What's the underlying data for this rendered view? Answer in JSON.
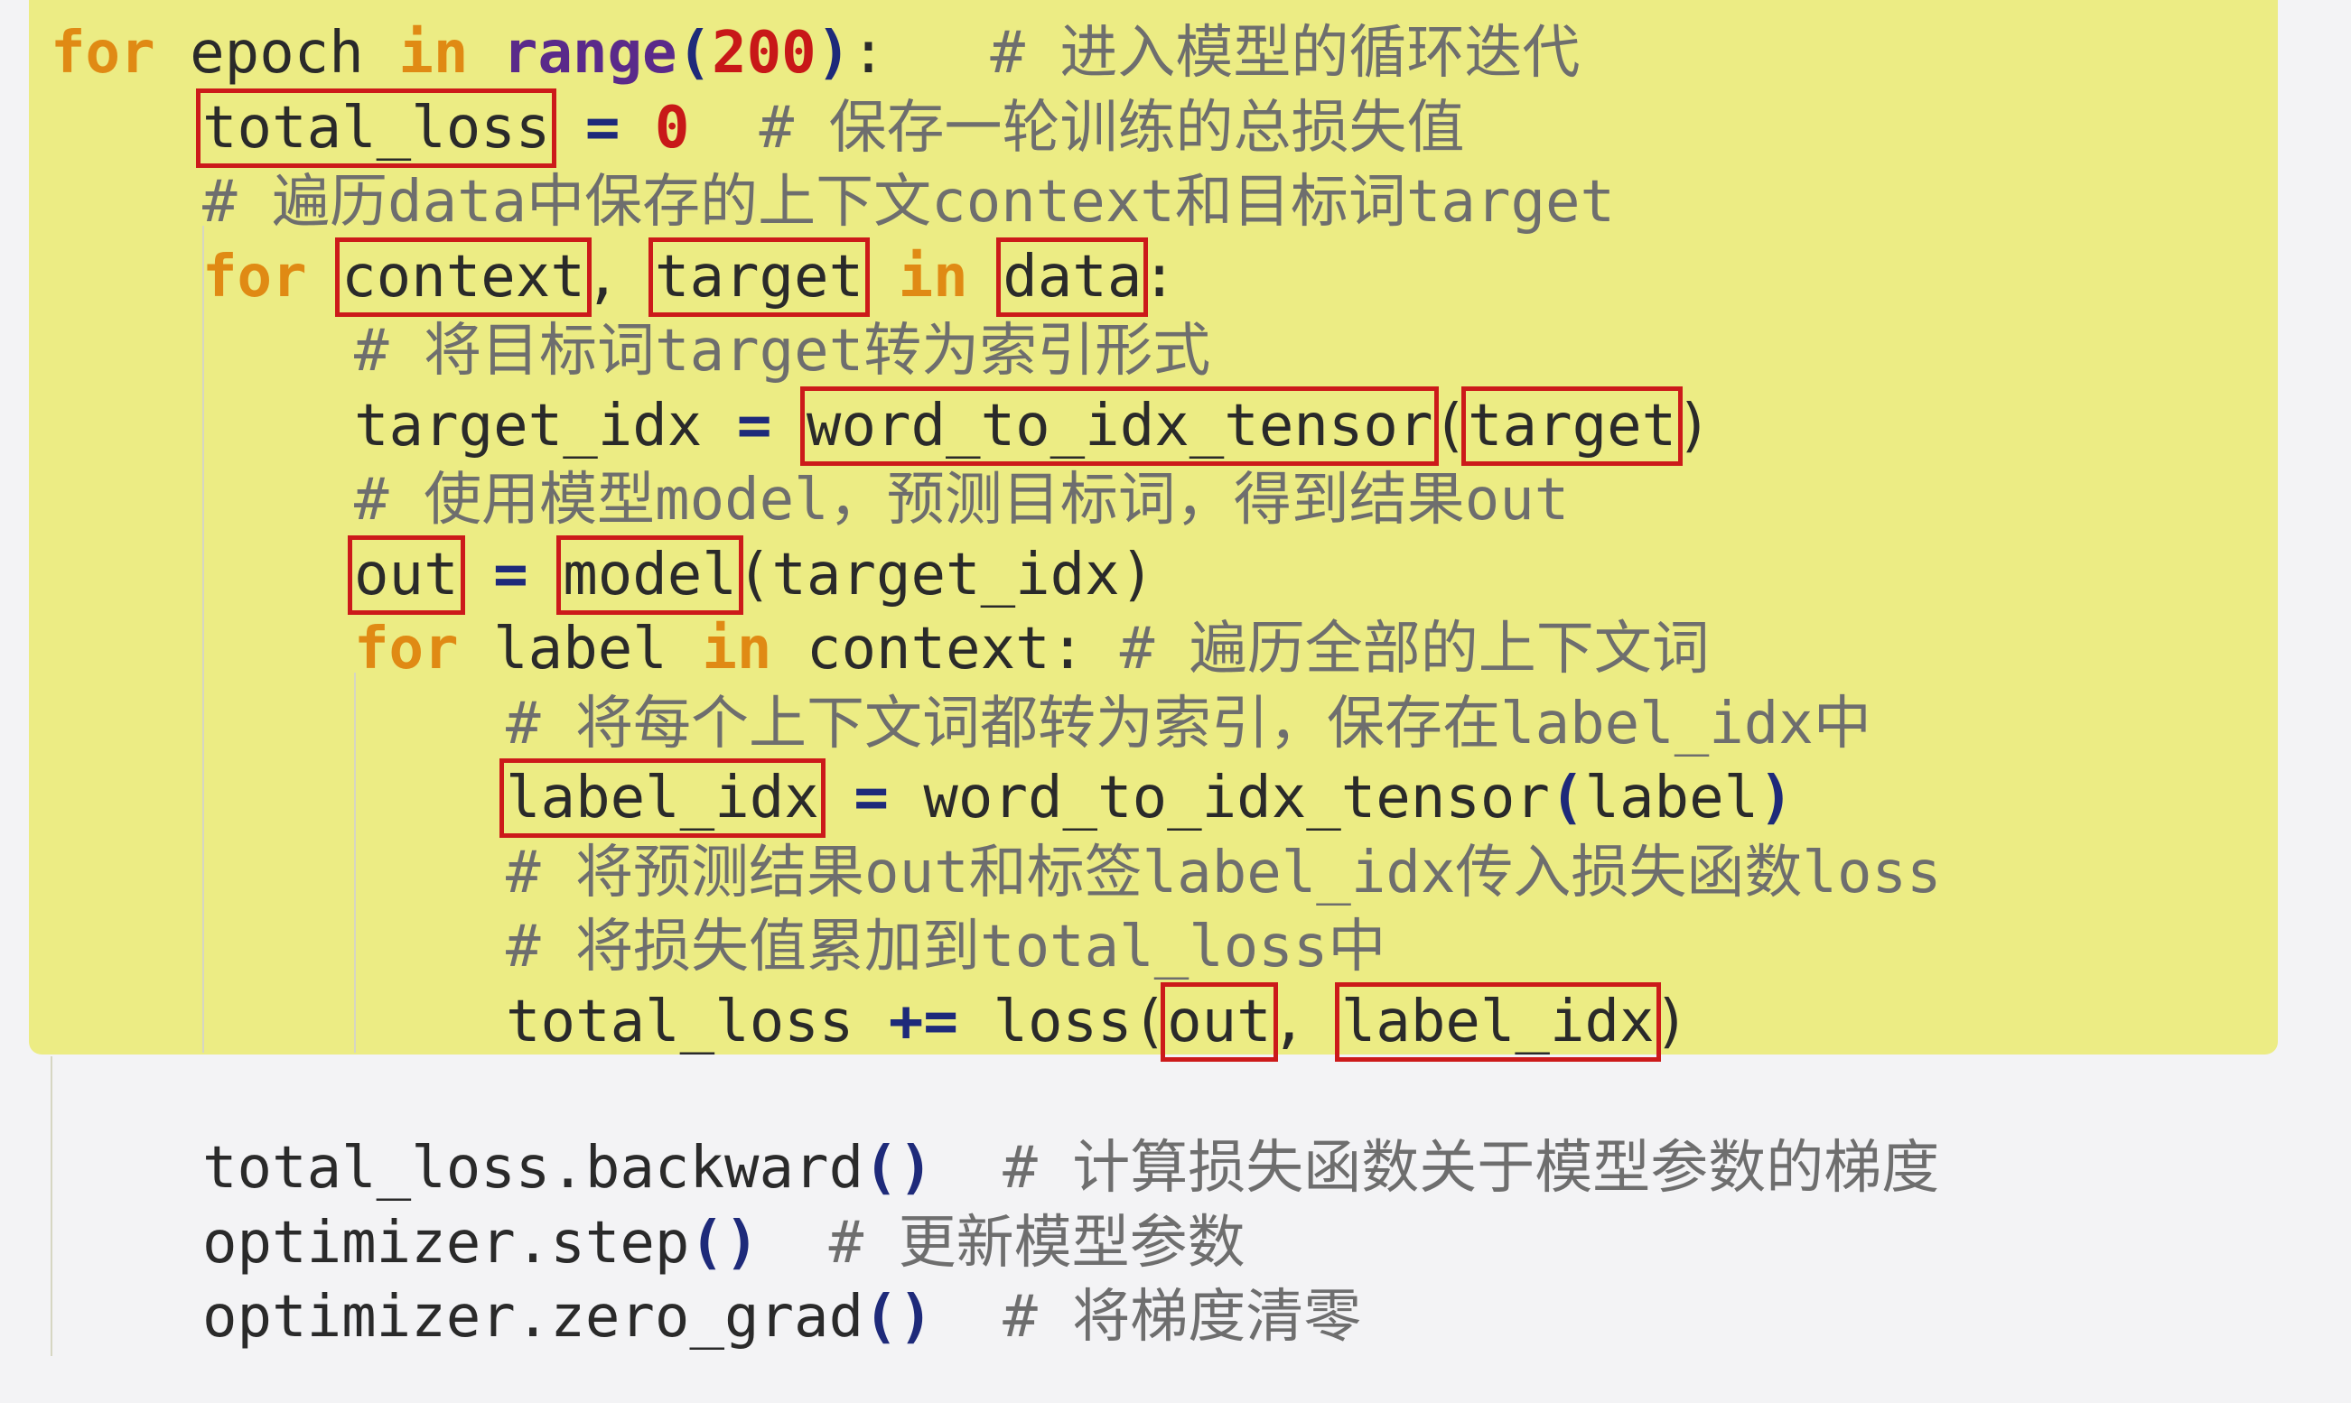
{
  "lines": [
    {
      "parts": [
        {
          "t": "for",
          "c": "kw"
        },
        {
          "t": " epoch "
        },
        {
          "t": "in",
          "c": "kw"
        },
        {
          "t": " "
        },
        {
          "t": "range",
          "c": "bi"
        },
        {
          "t": "(",
          "c": "op"
        },
        {
          "t": "200",
          "c": "num"
        },
        {
          "t": ")",
          "c": "op"
        },
        {
          "t": ":"
        },
        {
          "t": "   # 进入模型的循环迭代",
          "c": "cm"
        }
      ]
    },
    {
      "parts": [
        {
          "t": "total_loss",
          "box": true
        },
        {
          "t": " "
        },
        {
          "t": "=",
          "c": "op"
        },
        {
          "t": " "
        },
        {
          "t": "0",
          "c": "num"
        },
        {
          "t": "  # 保存一轮训练的总损失值",
          "c": "cm"
        }
      ]
    },
    {
      "parts": [
        {
          "t": "# 遍历data中保存的上下文context和目标词target",
          "c": "cm"
        }
      ]
    },
    {
      "parts": [
        {
          "t": "for",
          "c": "kw"
        },
        {
          "t": " "
        },
        {
          "t": "context",
          "box": true
        },
        {
          "t": ", "
        },
        {
          "t": "target",
          "box": true
        },
        {
          "t": " "
        },
        {
          "t": "in",
          "c": "kw"
        },
        {
          "t": " "
        },
        {
          "t": "data",
          "box": true
        },
        {
          "t": ":"
        }
      ]
    },
    {
      "parts": [
        {
          "t": "# 将目标词target转为索引形式",
          "c": "cm"
        }
      ]
    },
    {
      "parts": [
        {
          "t": "target_idx "
        },
        {
          "t": "=",
          "c": "op"
        },
        {
          "t": " "
        },
        {
          "t": "word_to_idx_tensor",
          "box": true
        },
        {
          "t": "("
        },
        {
          "t": "target",
          "box": true
        },
        {
          "t": ")"
        }
      ]
    },
    {
      "parts": [
        {
          "t": "# 使用模型model，预测目标词，得到结果out",
          "c": "cm"
        }
      ]
    },
    {
      "parts": [
        {
          "t": "out",
          "box": true
        },
        {
          "t": " "
        },
        {
          "t": "=",
          "c": "op"
        },
        {
          "t": " "
        },
        {
          "t": "model",
          "box": true
        },
        {
          "t": "(target_idx)"
        }
      ]
    },
    {
      "parts": [
        {
          "t": "for",
          "c": "kw"
        },
        {
          "t": " label "
        },
        {
          "t": "in",
          "c": "kw"
        },
        {
          "t": " context: "
        },
        {
          "t": "# 遍历全部的上下文词",
          "c": "cm"
        }
      ]
    },
    {
      "parts": [
        {
          "t": "# 将每个上下文词都转为索引，保存在label_idx中",
          "c": "cm"
        }
      ]
    },
    {
      "parts": [
        {
          "t": "label_idx",
          "box": true
        },
        {
          "t": " "
        },
        {
          "t": "=",
          "c": "op"
        },
        {
          "t": " word_to_idx_tensor"
        },
        {
          "t": "(",
          "c": "op"
        },
        {
          "t": "label"
        },
        {
          "t": ")",
          "c": "op"
        }
      ]
    },
    {
      "parts": [
        {
          "t": "# 将预测结果out和标签label_idx传入损失函数loss",
          "c": "cm"
        }
      ]
    },
    {
      "parts": [
        {
          "t": "# 将损失值累加到total_loss中",
          "c": "cm"
        }
      ]
    },
    {
      "parts": [
        {
          "t": "total_loss "
        },
        {
          "t": "+=",
          "c": "op"
        },
        {
          "t": " loss("
        },
        {
          "t": "out",
          "box": true
        },
        {
          "t": ", "
        },
        {
          "t": "label_idx",
          "box": true
        },
        {
          "t": ")"
        }
      ]
    },
    {
      "parts": [
        {
          "t": "total_loss.backward"
        },
        {
          "t": "()",
          "c": "op"
        },
        {
          "t": "  # 计算损失函数关于模型参数的梯度",
          "c": "cm"
        }
      ]
    },
    {
      "parts": [
        {
          "t": "optimizer.step"
        },
        {
          "t": "()",
          "c": "op"
        },
        {
          "t": "  # 更新模型参数",
          "c": "cm"
        }
      ]
    },
    {
      "parts": [
        {
          "t": "optimizer.zero_grad"
        },
        {
          "t": "()",
          "c": "op"
        },
        {
          "t": "  # 将梯度清零",
          "c": "cm"
        }
      ]
    }
  ]
}
